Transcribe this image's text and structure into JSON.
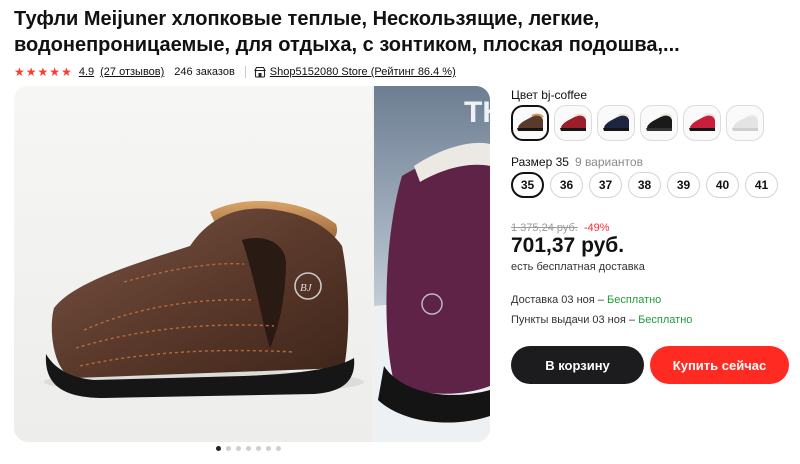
{
  "product": {
    "title": "Туфли Meijuner хлопковые теплые, Нескользящие, легкие, водонепроницаемые, для отдыха, с зонтиком, плоская подошва,...",
    "rating": "4.9",
    "rating_stars": 5,
    "reviews": "(27 отзывов)",
    "orders": "246 заказов",
    "store": "Shop5152080 Store (Рейтинг 86.4 %)"
  },
  "gallery": {
    "slide_count": 7,
    "active_index": 0,
    "next_slide_overlay_text": "TH"
  },
  "color": {
    "label": "Цвет bj-coffee",
    "options": [
      {
        "name": "bj-coffee",
        "hex": "#5a3a2a",
        "selected": true
      },
      {
        "name": "red",
        "hex": "#9a1f2a",
        "selected": false
      },
      {
        "name": "navy",
        "hex": "#1e2540",
        "selected": false
      },
      {
        "name": "black",
        "hex": "#1a1a1a",
        "selected": false
      },
      {
        "name": "rose",
        "hex": "#c81f3c",
        "selected": false
      },
      {
        "name": "white",
        "hex": "#e4e4e4",
        "selected": false
      }
    ]
  },
  "size": {
    "label": "Размер 35",
    "variants": "9 вариантов",
    "options": [
      "35",
      "36",
      "37",
      "38",
      "39",
      "40",
      "41"
    ],
    "selected": "35"
  },
  "price": {
    "old": "1 375,24 руб.",
    "discount": "-49%",
    "current": "701,37 руб.",
    "shipping": "есть бесплатная доставка"
  },
  "delivery": {
    "courier_label": "Доставка 03 ноя –",
    "courier_value": "Бесплатно",
    "pickup_label": "Пункты выдачи 03 ноя –",
    "pickup_value": "Бесплатно"
  },
  "actions": {
    "cart_label": "В корзину",
    "buy_label": "Купить сейчас"
  },
  "colors": {
    "accent_red": "#ff2a22",
    "dark_button": "#1c1c1e",
    "star": "#ff3b30",
    "free_green": "#1f9d3a"
  }
}
